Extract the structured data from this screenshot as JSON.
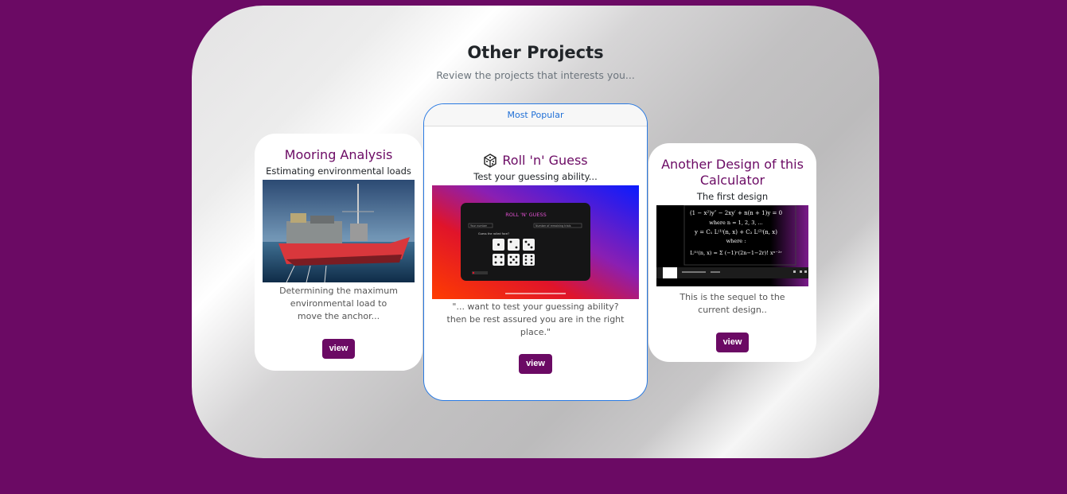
{
  "section": {
    "title": "Other Projects",
    "subtitle": "Review the projects that interests you..."
  },
  "cards": [
    {
      "title": "Mooring Analysis",
      "subtitle": "Estimating environmental loads",
      "desc_lines": [
        "Determining the maximum",
        "environmental load to",
        "move the anchor..."
      ],
      "button": "view"
    },
    {
      "badge": "Most Popular",
      "title": "Roll 'n' Guess",
      "subtitle": "Test your guessing ability...",
      "desc_lines": [
        "\"... want to test your guessing ability?",
        "then be rest assured you are in the right",
        "place.\""
      ],
      "button": "view",
      "screenshot": {
        "app_title": "ROLL 'N' GUESS",
        "field_left": "Your number",
        "field_right": "Number of remaining trials",
        "prompt": "Guess the rolled face?"
      }
    },
    {
      "title_lines": [
        "Another Design of this",
        "Calculator"
      ],
      "subtitle": "The first design",
      "desc_lines": [
        "This is the sequel to the",
        "current design.."
      ],
      "button": "view",
      "equation_lines": [
        "(1 − x²)y″ − 2xy′ + n(n + 1)y = 0",
        "where n = 1, 2, 3, ...",
        "y = C₁ L⁽¹⁾(n, x) + C₂ L⁽²⁾(n, x)",
        "where :"
      ]
    }
  ],
  "colors": {
    "background": "#6b0a64",
    "accent": "#6b0a64",
    "badge_text": "#1f6fd6"
  }
}
